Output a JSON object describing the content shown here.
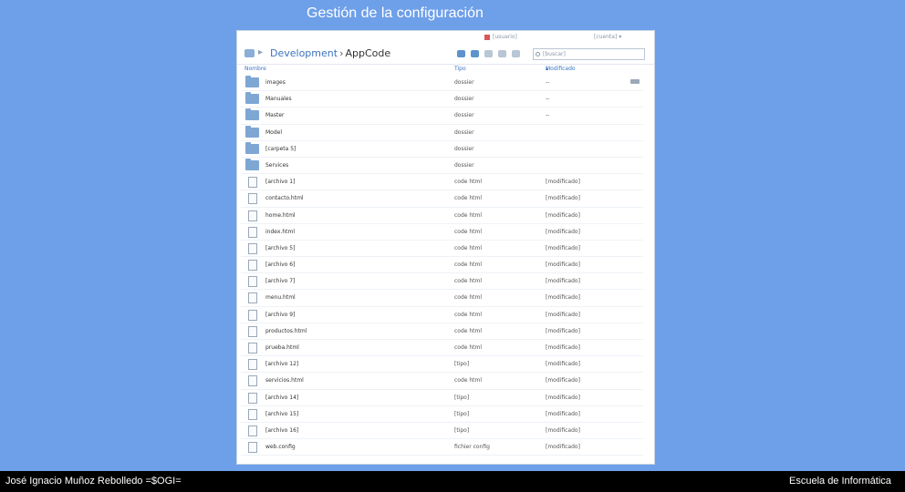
{
  "slide": {
    "title": "Gestión de la configuración",
    "footer_left": "José Ignacio Muñoz Rebolledo =$OGI=",
    "footer_right": "Escuela de Informática"
  },
  "browser": {
    "user_label": "[usuario]",
    "account_label": "[cuenta]",
    "breadcrumb": {
      "parent": "Development",
      "separator": "›",
      "current": "AppCode"
    },
    "search_placeholder": "[buscar]",
    "columns": {
      "name": "Nombre",
      "type": "Tipo",
      "modified": "Modificado"
    },
    "rows": [
      {
        "kind": "folder",
        "name": "images",
        "type": "dossier",
        "modified": "--"
      },
      {
        "kind": "folder",
        "name": "Manuales",
        "type": "dossier",
        "modified": "--"
      },
      {
        "kind": "folder",
        "name": "Master",
        "type": "dossier",
        "modified": "--"
      },
      {
        "kind": "folder",
        "name": "Model",
        "type": "dossier",
        "modified": ""
      },
      {
        "kind": "folder",
        "name": "[carpeta 5]",
        "type": "dossier",
        "modified": ""
      },
      {
        "kind": "folder",
        "name": "Services",
        "type": "dossier",
        "modified": ""
      },
      {
        "kind": "file",
        "name": "[archivo 1]",
        "type": "code html",
        "modified": "[modificado]"
      },
      {
        "kind": "file",
        "name": "contacto.html",
        "type": "code html",
        "modified": "[modificado]"
      },
      {
        "kind": "file",
        "name": "home.html",
        "type": "code html",
        "modified": "[modificado]"
      },
      {
        "kind": "file",
        "name": "index.html",
        "type": "code html",
        "modified": "[modificado]"
      },
      {
        "kind": "file",
        "name": "[archivo 5]",
        "type": "code html",
        "modified": "[modificado]"
      },
      {
        "kind": "file",
        "name": "[archivo 6]",
        "type": "code html",
        "modified": "[modificado]"
      },
      {
        "kind": "file",
        "name": "[archivo 7]",
        "type": "code html",
        "modified": "[modificado]"
      },
      {
        "kind": "file",
        "name": "menu.html",
        "type": "code html",
        "modified": "[modificado]"
      },
      {
        "kind": "file",
        "name": "[archivo 9]",
        "type": "code html",
        "modified": "[modificado]"
      },
      {
        "kind": "file",
        "name": "productos.html",
        "type": "code html",
        "modified": "[modificado]"
      },
      {
        "kind": "file",
        "name": "prueba.html",
        "type": "code html",
        "modified": "[modificado]"
      },
      {
        "kind": "file",
        "name": "[archivo 12]",
        "type": "[tipo]",
        "modified": "[modificado]"
      },
      {
        "kind": "file",
        "name": "servicios.html",
        "type": "code html",
        "modified": "[modificado]"
      },
      {
        "kind": "file",
        "name": "[archivo 14]",
        "type": "[tipo]",
        "modified": "[modificado]"
      },
      {
        "kind": "file",
        "name": "[archivo 15]",
        "type": "[tipo]",
        "modified": "[modificado]"
      },
      {
        "kind": "file",
        "name": "[archivo 16]",
        "type": "[tipo]",
        "modified": "[modificado]"
      },
      {
        "kind": "file",
        "name": "web.config",
        "type": "fichier config",
        "modified": "[modificado]"
      }
    ]
  }
}
